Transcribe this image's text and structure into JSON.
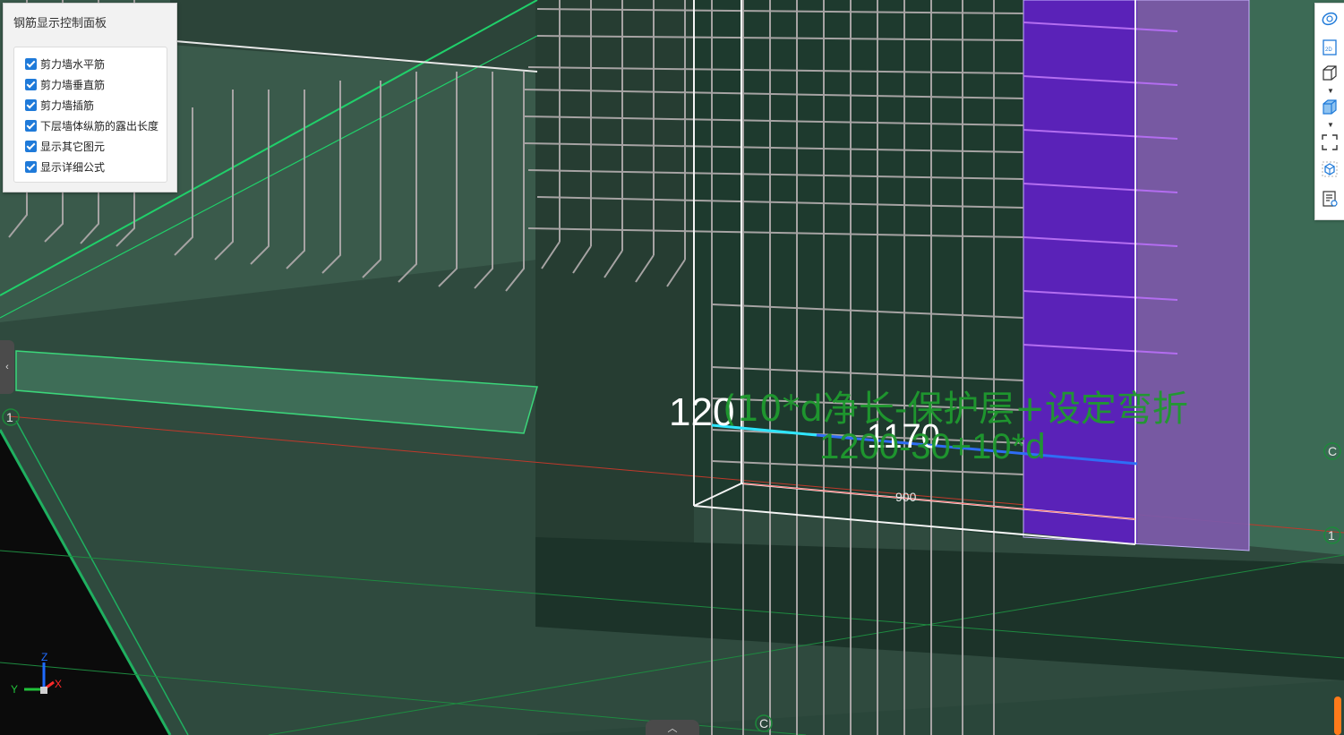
{
  "panel": {
    "title": "钢筋显示控制面板",
    "options": [
      {
        "label": "剪力墙水平筋",
        "checked": true
      },
      {
        "label": "剪力墙垂直筋",
        "checked": true
      },
      {
        "label": "剪力墙插筋",
        "checked": true
      },
      {
        "label": "下层墙体纵筋的露出长度",
        "checked": true
      },
      {
        "label": "显示其它图元",
        "checked": true
      },
      {
        "label": "显示详细公式",
        "checked": true
      }
    ]
  },
  "viewport": {
    "dim_left": "120",
    "dim_mid": "1170",
    "formula_line1": "(10*d净长-保护层+设定弯折",
    "formula_line2": "1200-30+10*d",
    "dim_bottom": "900",
    "axis_left_1": "1",
    "axis_right_1": "1",
    "axis_right_c": "C",
    "axis_bottom_c": "C",
    "gizmo_z": "Z",
    "gizmo_y": "Y",
    "gizmo_x": "X"
  },
  "toolbar": {
    "items": [
      "rotate-view-icon",
      "2d-view-icon",
      "wireframe-box-icon",
      "solid-box-icon",
      "fullscreen-icon",
      "home-view-icon",
      "report-icon"
    ],
    "label_2d": "2D"
  },
  "colors": {
    "scene_bg": "#2f4a3e",
    "purple_wall": "#5a22b8",
    "rebar_gray": "#a6a3a3",
    "formula_green": "#1f9a2e",
    "dim_cyan": "#2fe6ff",
    "dim_blue": "#2f6df5"
  }
}
